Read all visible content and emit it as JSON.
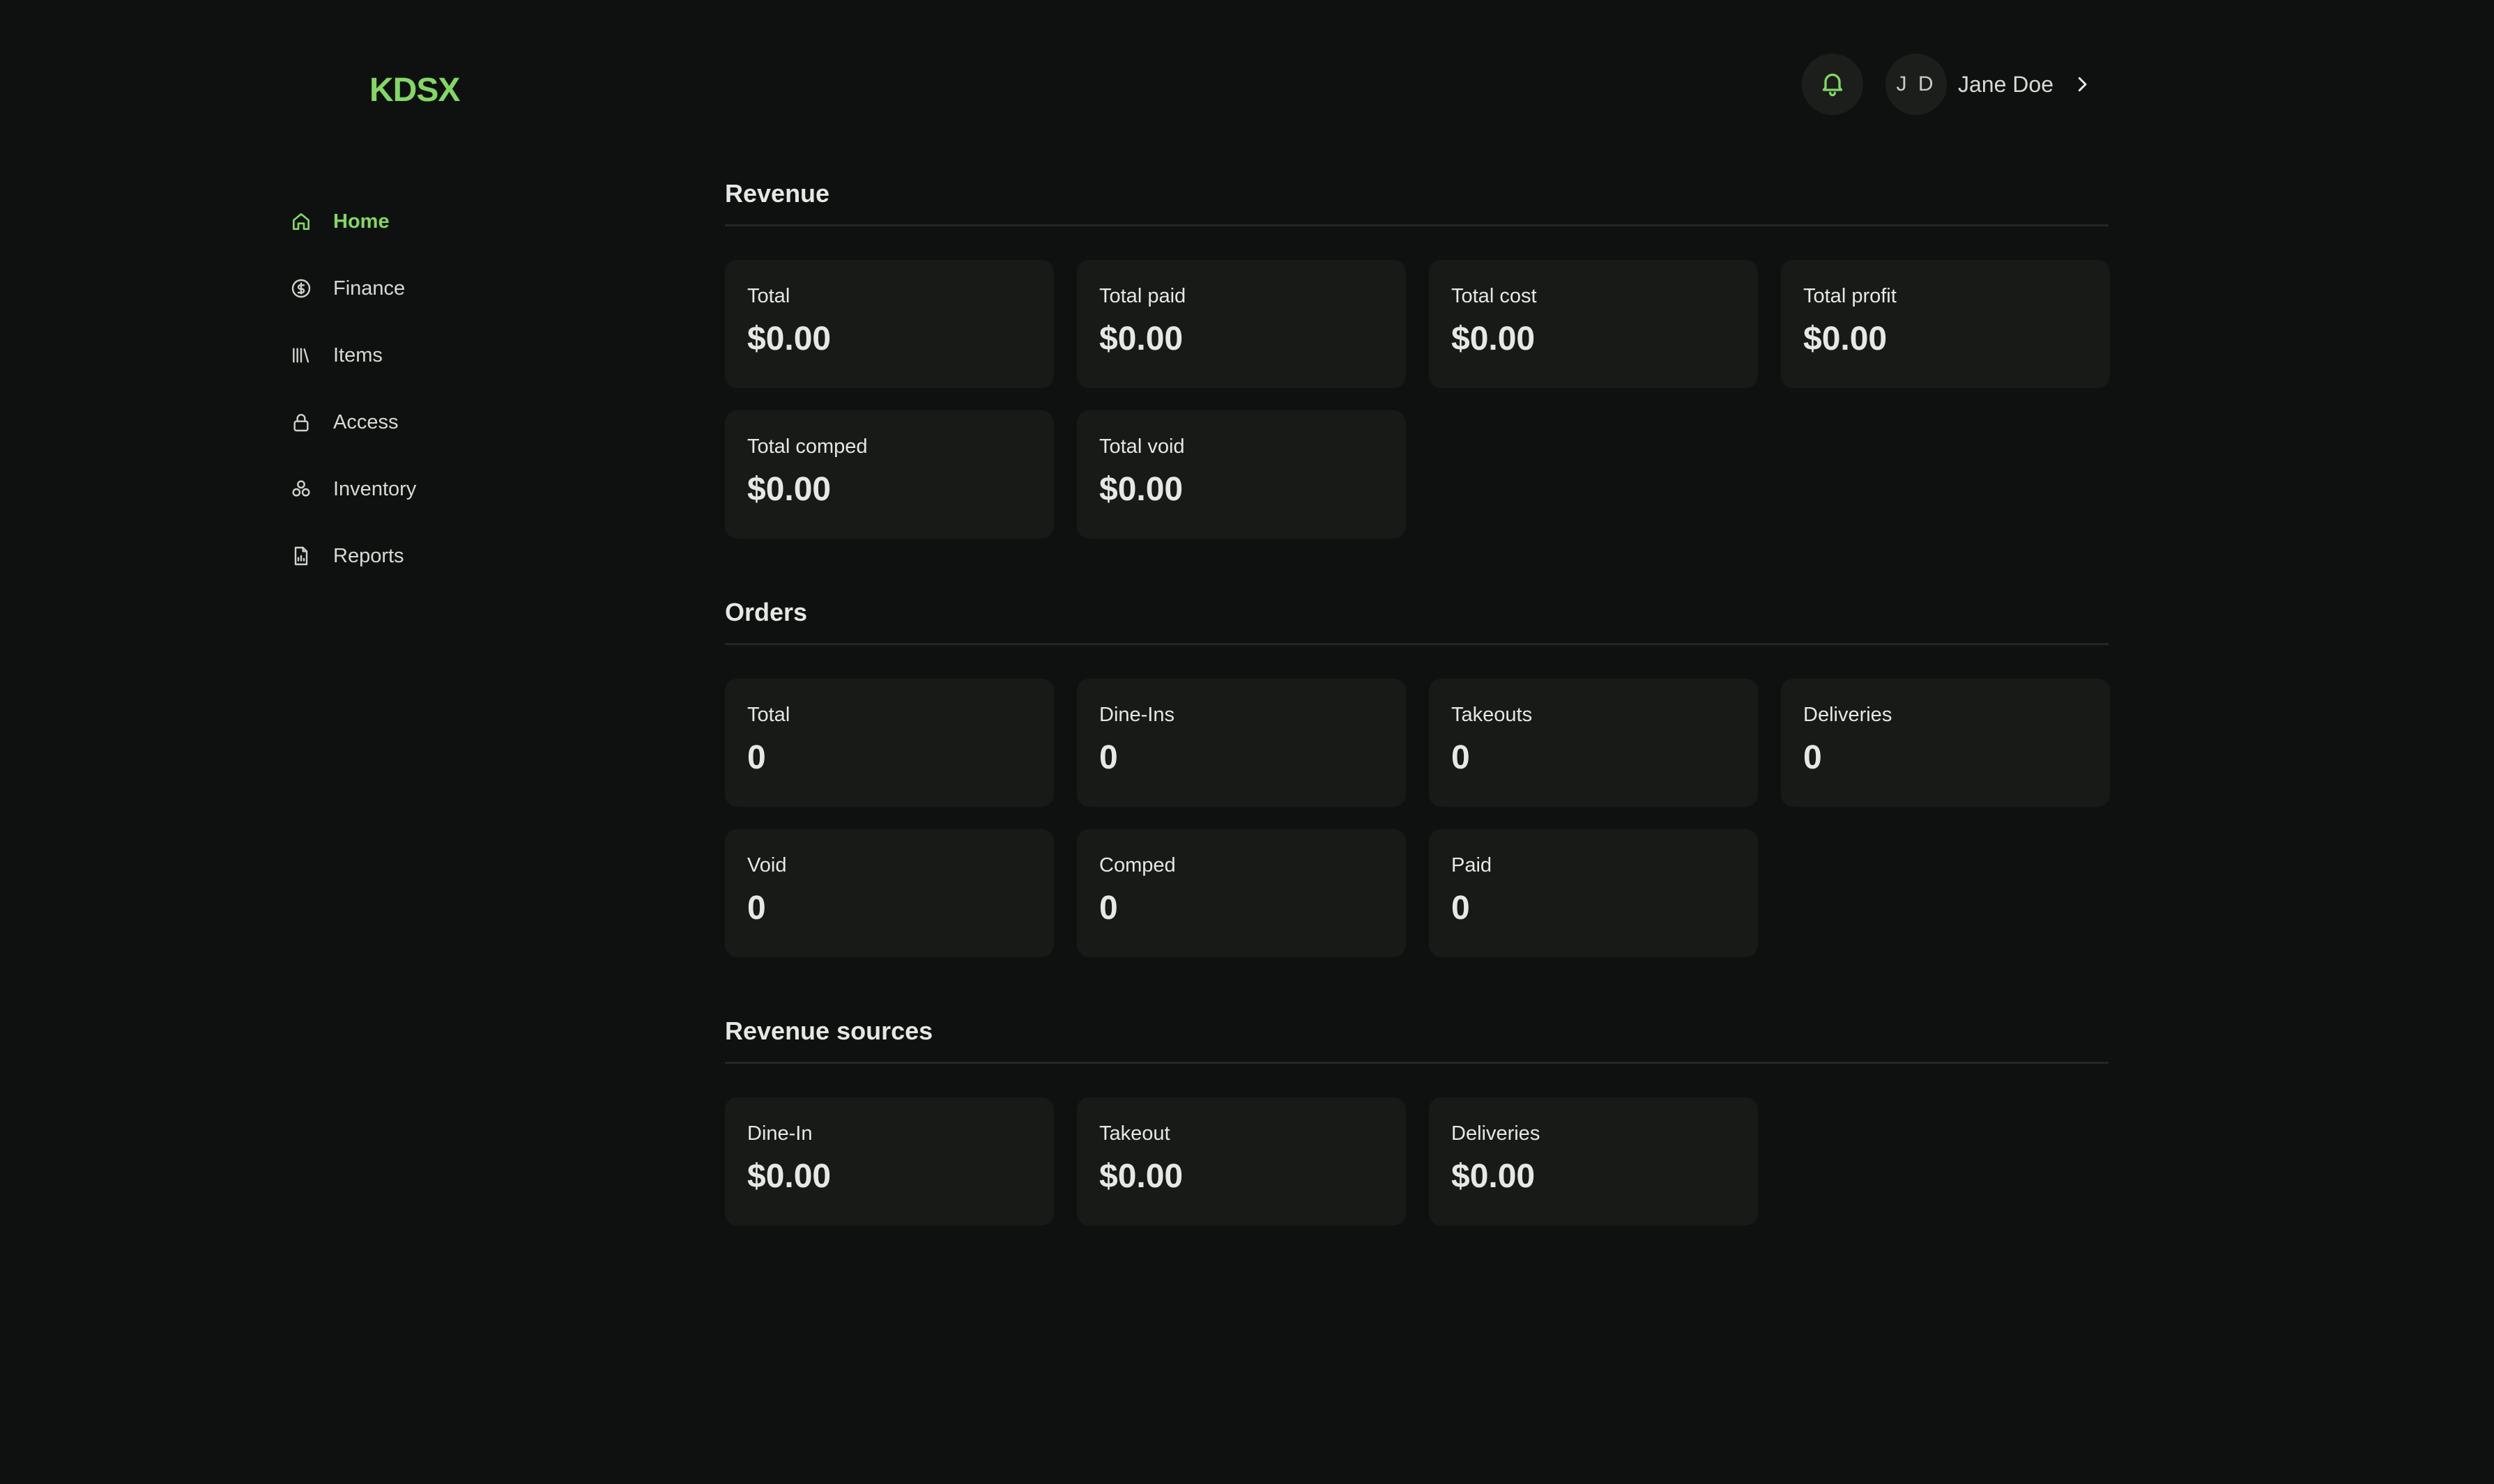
{
  "app": {
    "logo": "KDSX"
  },
  "sidebar": {
    "items": [
      {
        "label": "Home",
        "icon": "home-icon",
        "active": true
      },
      {
        "label": "Finance",
        "icon": "dollar-circle-icon",
        "active": false
      },
      {
        "label": "Items",
        "icon": "library-icon",
        "active": false
      },
      {
        "label": "Access",
        "icon": "lock-icon",
        "active": false
      },
      {
        "label": "Inventory",
        "icon": "boxes-icon",
        "active": false
      },
      {
        "label": "Reports",
        "icon": "report-file-icon",
        "active": false
      }
    ]
  },
  "header": {
    "notifications_icon": "bell-icon",
    "user": {
      "initials": "J D",
      "name": "Jane Doe",
      "menu_icon": "chevron-right-icon"
    }
  },
  "revenue": {
    "title": "Revenue",
    "cards": [
      {
        "label": "Total",
        "value": "$0.00"
      },
      {
        "label": "Total paid",
        "value": "$0.00"
      },
      {
        "label": "Total cost",
        "value": "$0.00"
      },
      {
        "label": "Total profit",
        "value": "$0.00"
      },
      {
        "label": "Total comped",
        "value": "$0.00"
      },
      {
        "label": "Total void",
        "value": "$0.00"
      }
    ]
  },
  "orders": {
    "title": "Orders",
    "cards": [
      {
        "label": "Total",
        "value": "0"
      },
      {
        "label": "Dine-Ins",
        "value": "0"
      },
      {
        "label": "Takeouts",
        "value": "0"
      },
      {
        "label": "Deliveries",
        "value": "0"
      },
      {
        "label": "Void",
        "value": "0"
      },
      {
        "label": "Comped",
        "value": "0"
      },
      {
        "label": "Paid",
        "value": "0"
      }
    ]
  },
  "revenue_sources": {
    "title": "Revenue sources",
    "cards": [
      {
        "label": "Dine-In",
        "value": "$0.00"
      },
      {
        "label": "Takeout",
        "value": "$0.00"
      },
      {
        "label": "Deliveries",
        "value": "$0.00"
      }
    ]
  },
  "colors": {
    "background": "#0f1110",
    "card": "#181a18",
    "accent": "#84d667",
    "text": "#e6e8e3"
  }
}
